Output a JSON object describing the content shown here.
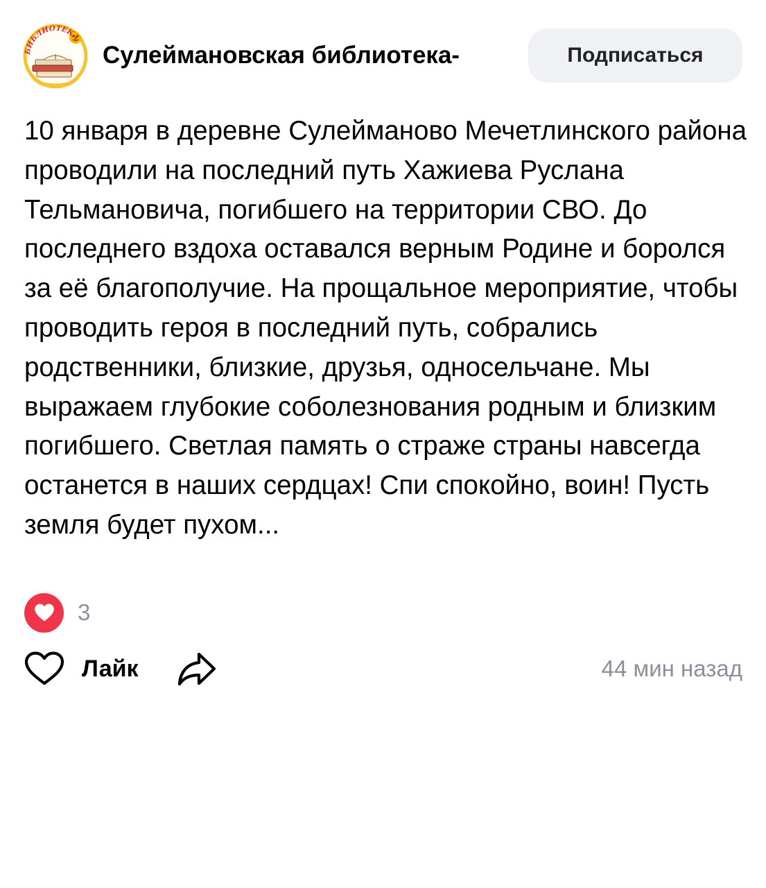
{
  "header": {
    "author_name": "Сулеймановская библиотека-",
    "avatar_logo_text": "БИБЛИОТЕКА",
    "subscribe_label": "Подписаться"
  },
  "post": {
    "text": "10 января в деревне Сулейманово Мечетлинского района проводили на последний путь Хажиева Руслана Тельмановича, погибшего на территории СВО. До последнего вздоха оставался верным Родине и боролся за её благополучие. На прощальное мероприятие, чтобы проводить героя в последний путь, собрались родственники, близкие, друзья, односельчане. Мы выражаем глубокие соболезнования родным и близким погибшего. Светлая память о страже страны навсегда останется в наших сердцах! Спи спокойно, воин! Пусть земля будет пухом..."
  },
  "reactions": {
    "icon": "heart-icon",
    "count": "3",
    "color": "#f0354b"
  },
  "actions": {
    "like_label": "Лайк",
    "like_icon": "heart-outline-icon",
    "share_icon": "share-arrow-icon",
    "timestamp": "44 мин назад"
  },
  "colors": {
    "accent_red": "#f0354b",
    "muted_text": "#8a919c",
    "button_bg": "#f0f1f4"
  }
}
